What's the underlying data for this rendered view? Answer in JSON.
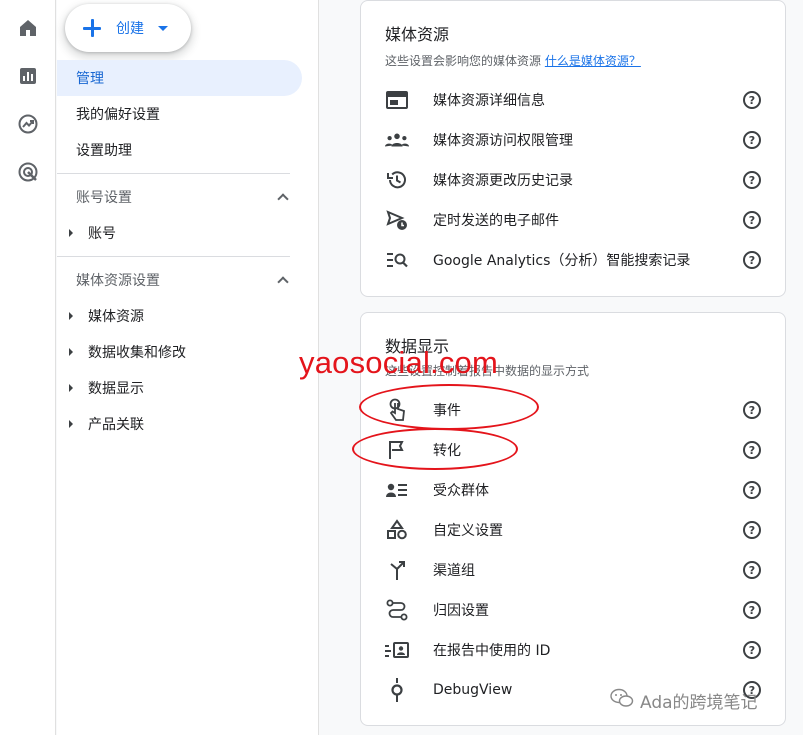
{
  "colors": {
    "accent": "#1a73e8",
    "active_bg": "#e8f0fe",
    "annotation": "#e4141b"
  },
  "rail": [
    {
      "name": "home-icon"
    },
    {
      "name": "reports-icon"
    },
    {
      "name": "explore-icon"
    },
    {
      "name": "advertising-icon"
    }
  ],
  "create_button": {
    "label": "创建"
  },
  "nav": {
    "admin": "管理",
    "preferences": "我的偏好设置",
    "setup_assistant": "设置助理",
    "account_settings": "账号设置",
    "account": "账号",
    "property_settings": "媒体资源设置",
    "property_items": [
      "媒体资源",
      "数据收集和修改",
      "数据显示",
      "产品关联"
    ]
  },
  "card_property": {
    "title": "媒体资源",
    "subtitle": "这些设置会影响您的媒体资源",
    "subtitle_link": "什么是媒体资源？",
    "rows": [
      {
        "label": "媒体资源详细信息",
        "icon": "property-details-icon"
      },
      {
        "label": "媒体资源访问权限管理",
        "icon": "people-icon"
      },
      {
        "label": "媒体资源更改历史记录",
        "icon": "history-icon"
      },
      {
        "label": "定时发送的电子邮件",
        "icon": "scheduled-email-icon"
      },
      {
        "label": "Google Analytics（分析）智能搜索记录",
        "icon": "search-history-icon"
      }
    ]
  },
  "card_display": {
    "title": "数据显示",
    "subtitle": "这些设置控制着报告中数据的显示方式",
    "rows": [
      {
        "label": "事件",
        "icon": "touch-icon"
      },
      {
        "label": "转化",
        "icon": "flag-icon"
      },
      {
        "label": "受众群体",
        "icon": "audience-icon"
      },
      {
        "label": "自定义设置",
        "icon": "shapes-icon"
      },
      {
        "label": "渠道组",
        "icon": "merge-icon"
      },
      {
        "label": "归因设置",
        "icon": "route-icon"
      },
      {
        "label": "在报告中使用的 ID",
        "icon": "id-icon"
      },
      {
        "label": "DebugView",
        "icon": "debug-icon"
      }
    ]
  },
  "help_glyph": "?",
  "watermark": "yaosocial.com",
  "wechat_caption": "Ada的跨境笔记"
}
